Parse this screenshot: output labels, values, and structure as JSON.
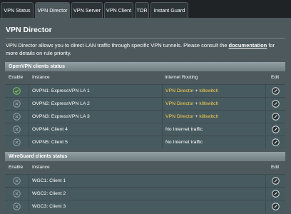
{
  "tabs": [
    {
      "label": "VPN Status"
    },
    {
      "label": "VPN Director"
    },
    {
      "label": "VPN Server"
    },
    {
      "label": "VPN Client"
    },
    {
      "label": "TOR"
    },
    {
      "label": "Instant Guard"
    }
  ],
  "page": {
    "title": "VPN Director",
    "description_before": "VPN Director allows you to direct LAN traffic through specific VPN tunnels. Please consult the ",
    "description_link": "documentation",
    "description_after": " for more details on rule priority."
  },
  "openvpn": {
    "header": "OpenVPN clients status",
    "columns": {
      "enable": "Enable",
      "instance": "Instance",
      "routing": "Internet Routing",
      "edit": "Edit"
    },
    "rows": [
      {
        "instance": "OVPN1: ExpressVPN LA 1",
        "routing_main": "VPN Director",
        "routing_sep": " + ",
        "routing_extra": "killswitch",
        "status": "active"
      },
      {
        "instance": "OVPN2: ExpressVPN LA 2",
        "routing_main": "VPN Director",
        "routing_sep": " + ",
        "routing_extra": "killswitch",
        "status": "inactive"
      },
      {
        "instance": "OVPN3: ExpressVPN LA 3",
        "routing_main": "VPN Director",
        "routing_sep": " + ",
        "routing_extra": "killswitch",
        "status": "inactive"
      },
      {
        "instance": "OVPN4: Client 4",
        "routing_main": "No Internet traffic",
        "routing_sep": "",
        "routing_extra": "",
        "status": "inactive"
      },
      {
        "instance": "OVPN5: Client 5",
        "routing_main": "No Internet traffic",
        "routing_sep": "",
        "routing_extra": "",
        "status": "inactive"
      }
    ]
  },
  "wireguard": {
    "header": "WireGuard clients status",
    "columns": {
      "enable": "Enable",
      "instance": "Instance",
      "edit": "Edit"
    },
    "rows": [
      {
        "instance": "WGC1: Client 1",
        "status": "inactive"
      },
      {
        "instance": "WGC2: Client 2",
        "status": "inactive"
      },
      {
        "instance": "WGC3: Client 3",
        "status": "inactive"
      }
    ]
  },
  "colors": {
    "panel": "#4d595d",
    "background": "#1f2325",
    "routing_highlight": "#fbd04c",
    "enabled_icon": "#7ec85a",
    "disabled_icon": "#9aa4a8"
  },
  "icons": {
    "enabled": "check-circle-icon",
    "disabled": "x-circle-icon",
    "edit": "pencil-circle-icon"
  }
}
